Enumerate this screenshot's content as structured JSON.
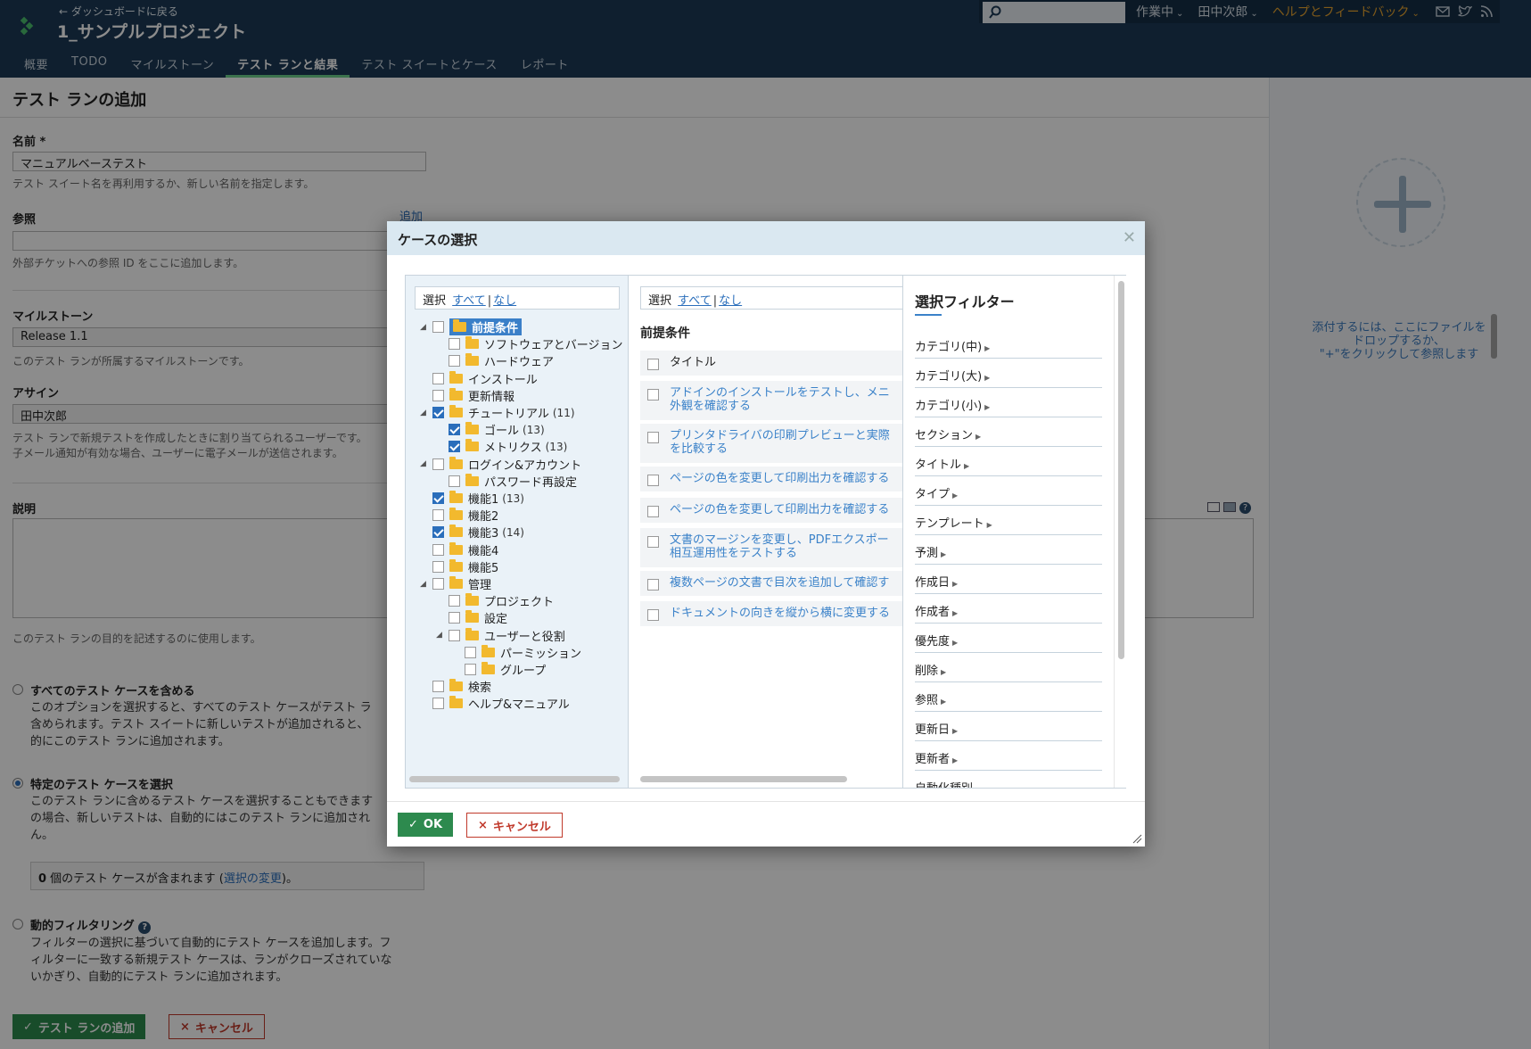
{
  "header": {
    "back_link": "← ダッシュボードに戻る",
    "project_title": "1_サンプルプロジェクト",
    "tabs": [
      "概要",
      "TODO",
      "マイルストーン",
      "テスト ランと結果",
      "テスト スイートとケース",
      "レポート"
    ],
    "active_tab": "テスト ランと結果",
    "menus": {
      "status": "作業中",
      "user": "田中次郎",
      "help": "ヘルプとフィードバック"
    },
    "icons": [
      "search-icon",
      "mail-icon",
      "twitter-icon",
      "rss-icon"
    ]
  },
  "page": {
    "title": "テスト ランの追加",
    "name_label": "名前 *",
    "name_value": "マニュアルベーステスト",
    "name_hint": "テスト スイート名を再利用するか、新しい名前を指定します。",
    "refs_label": "参照",
    "refs_add_link": "追加",
    "refs_hint": "外部チケットへの参照 ID をここに追加します。",
    "milestone_label": "マイルストーン",
    "milestone_value": "Release 1.1",
    "milestone_hint": "このテスト ランが所属するマイルストーンです。",
    "assign_label": "アサイン",
    "assign_value": "田中次郎",
    "assign_hint_1": "テスト ランで新規テストを作成したときに割り当てられるユーザーです。",
    "assign_hint_2": "子メール通知が有効な場合、ユーザーに電子メールが送信されます。",
    "desc_label": "説明",
    "desc_hint": "このテスト ランの目的を記述するのに使用します。",
    "option_all_title": "すべてのテスト ケースを含める",
    "option_all_desc_1": "このオプションを選択すると、すべてのテスト ケースがテスト ラ",
    "option_all_desc_2": "含められます。テスト スイートに新しいテストが追加されると、",
    "option_all_desc_3": "的にこのテスト ランに追加されます。",
    "option_select_title": "特定のテスト ケースを選択",
    "option_select_desc_1": "このテスト ランに含めるテスト ケースを選択することもできます",
    "option_select_desc_2": "の場合、新しいテストは、自動的にはこのテスト ランに追加され",
    "option_select_desc_3": "ん。",
    "included_count_prefix": "0",
    "included_count_text": " 個のテスト ケースが含まれます (",
    "included_change_link": "選択の変更",
    "included_suffix": ")。",
    "option_dynamic_title": "動的フィルタリング",
    "option_dynamic_desc_1": "フィルターの選択に基づいて自動的にテスト ケースを追加します。フ",
    "option_dynamic_desc_2": "ィルターに一致する新規テスト ケースは、ランがクローズされていな",
    "option_dynamic_desc_3": "いかぎり、自動的にテスト ランに追加されます。",
    "submit_button": "テスト ランの追加",
    "cancel_button": "キャンセル"
  },
  "sidepanel": {
    "attach_text_1": "添付するには、ここにファイルを",
    "attach_text_2": "ドロップするか、",
    "attach_text_3": "\"+\"をクリックして参照します"
  },
  "dialog": {
    "title": "ケースの選択",
    "select_label": "選択",
    "select_all": "すべて",
    "select_none": "なし",
    "sections_title": "前提条件",
    "tree": [
      {
        "label": "前提条件",
        "checked": false,
        "selected": true,
        "level": 0,
        "toggle": "▲"
      },
      {
        "label": "ソフトウェアとバージョン",
        "checked": false,
        "level": 1
      },
      {
        "label": "ハードウェア",
        "checked": false,
        "level": 1
      },
      {
        "label": "インストール",
        "checked": false,
        "level": 0
      },
      {
        "label": "更新情報",
        "checked": false,
        "level": 0
      },
      {
        "label": "チュートリアル",
        "count": "(11)",
        "checked": true,
        "level": 0,
        "toggle": "▲"
      },
      {
        "label": "ゴール",
        "count": "(13)",
        "checked": true,
        "level": 1
      },
      {
        "label": "メトリクス",
        "count": "(13)",
        "checked": true,
        "level": 1
      },
      {
        "label": "ログイン&アカウント",
        "checked": false,
        "level": 0,
        "toggle": "▲"
      },
      {
        "label": "パスワード再設定",
        "checked": false,
        "level": 1
      },
      {
        "label": "機能1",
        "count": "(13)",
        "checked": true,
        "level": 0
      },
      {
        "label": "機能2",
        "checked": false,
        "level": 0
      },
      {
        "label": "機能3",
        "count": "(14)",
        "checked": true,
        "level": 0
      },
      {
        "label": "機能4",
        "checked": false,
        "level": 0
      },
      {
        "label": "機能5",
        "checked": false,
        "level": 0
      },
      {
        "label": "管理",
        "checked": false,
        "level": 0,
        "toggle": "▲"
      },
      {
        "label": "プロジェクト",
        "checked": false,
        "level": 1
      },
      {
        "label": "設定",
        "checked": false,
        "level": 1
      },
      {
        "label": "ユーザーと役割",
        "checked": false,
        "level": 1,
        "toggle": "▲"
      },
      {
        "label": "パーミッション",
        "checked": false,
        "level": 2
      },
      {
        "label": "グループ",
        "checked": false,
        "level": 2
      },
      {
        "label": "検索",
        "checked": false,
        "level": 0
      },
      {
        "label": "ヘルプ&マニュアル",
        "checked": false,
        "level": 0
      }
    ],
    "cases": [
      {
        "lines": [
          "タイトル"
        ],
        "header": true
      },
      {
        "lines": [
          "アドインのインストールをテストし、メニ",
          "外観を確認する"
        ]
      },
      {
        "lines": [
          "プリンタドライバの印刷プレビューと実際",
          "を比較する"
        ]
      },
      {
        "lines": [
          "ページの色を変更して印刷出力を確認する"
        ]
      },
      {
        "lines": [
          "ページの色を変更して印刷出力を確認する"
        ]
      },
      {
        "lines": [
          "文書のマージンを変更し、PDFエクスポー",
          "相互運用性をテストする"
        ]
      },
      {
        "lines": [
          "複数ページの文書で目次を追加して確認す"
        ]
      },
      {
        "lines": [
          "ドキュメントの向きを縦から横に変更する"
        ]
      }
    ],
    "filter_title": "選択フィルター",
    "filters": [
      "カテゴリ(中)",
      "カテゴリ(大)",
      "カテゴリ(小)",
      "セクション",
      "タイトル",
      "タイプ",
      "テンプレート",
      "予測",
      "作成日",
      "作成者",
      "優先度",
      "削除",
      "参照",
      "更新日",
      "更新者",
      "自動化種別"
    ],
    "ok_button": "OK",
    "cancel_button": "キャンセル"
  },
  "colors": {
    "header_bg": "#1c3a56",
    "accent_green": "#2d8a4e",
    "link_blue": "#2a6ebb",
    "help_orange": "#e8a530",
    "cancel_red": "#c0392b"
  }
}
